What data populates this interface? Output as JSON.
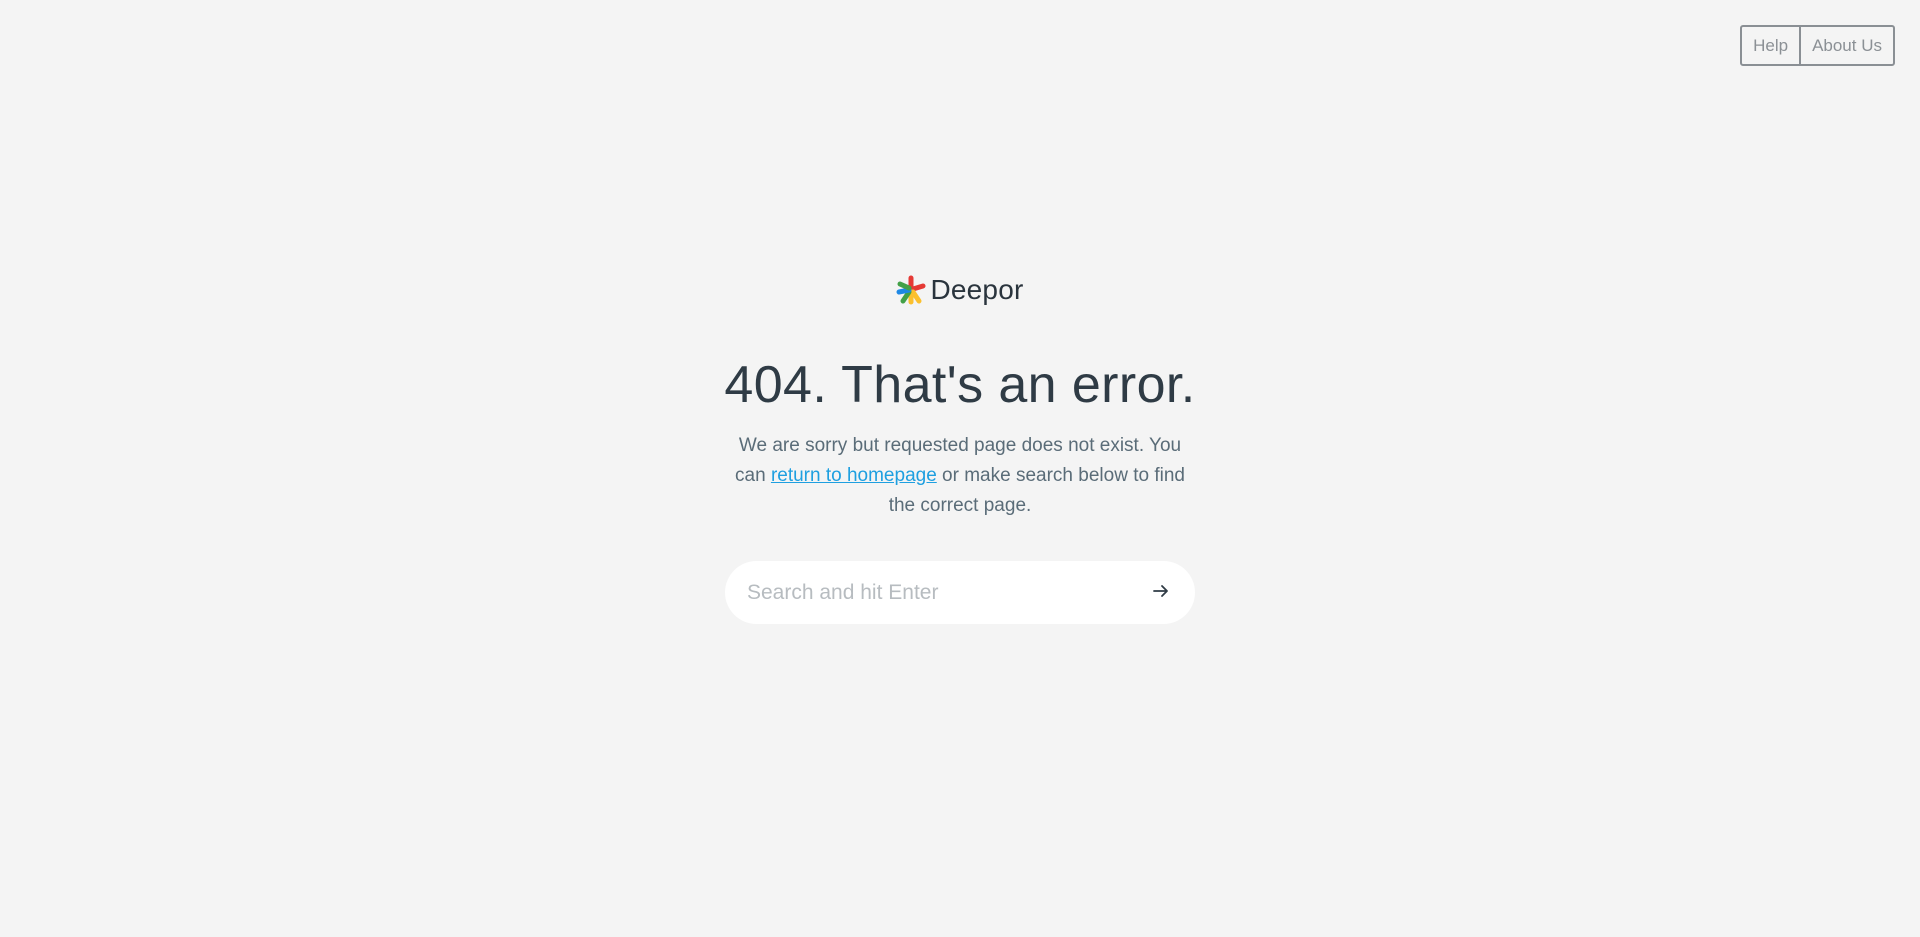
{
  "nav": {
    "help_label": "Help",
    "about_label": "About Us"
  },
  "brand": {
    "name": "Deepor",
    "logo_icon": "asterisk-multicolor-icon",
    "logo_colors": [
      "#e53935",
      "#fbc02d",
      "#43a047",
      "#1e88e5"
    ]
  },
  "error": {
    "title": "404. That's an error.",
    "message_before": "We are sorry but requested page does not exist. You can ",
    "link_text": "return to homepage",
    "message_after": " or make search below to find the correct page."
  },
  "search": {
    "placeholder": "Search and hit Enter",
    "value": "",
    "submit_icon": "arrow-right-icon"
  },
  "colors": {
    "background": "#f4f4f4",
    "link": "#1e9fe0",
    "text": "#2f3b45",
    "muted_text": "#5a6c78"
  }
}
